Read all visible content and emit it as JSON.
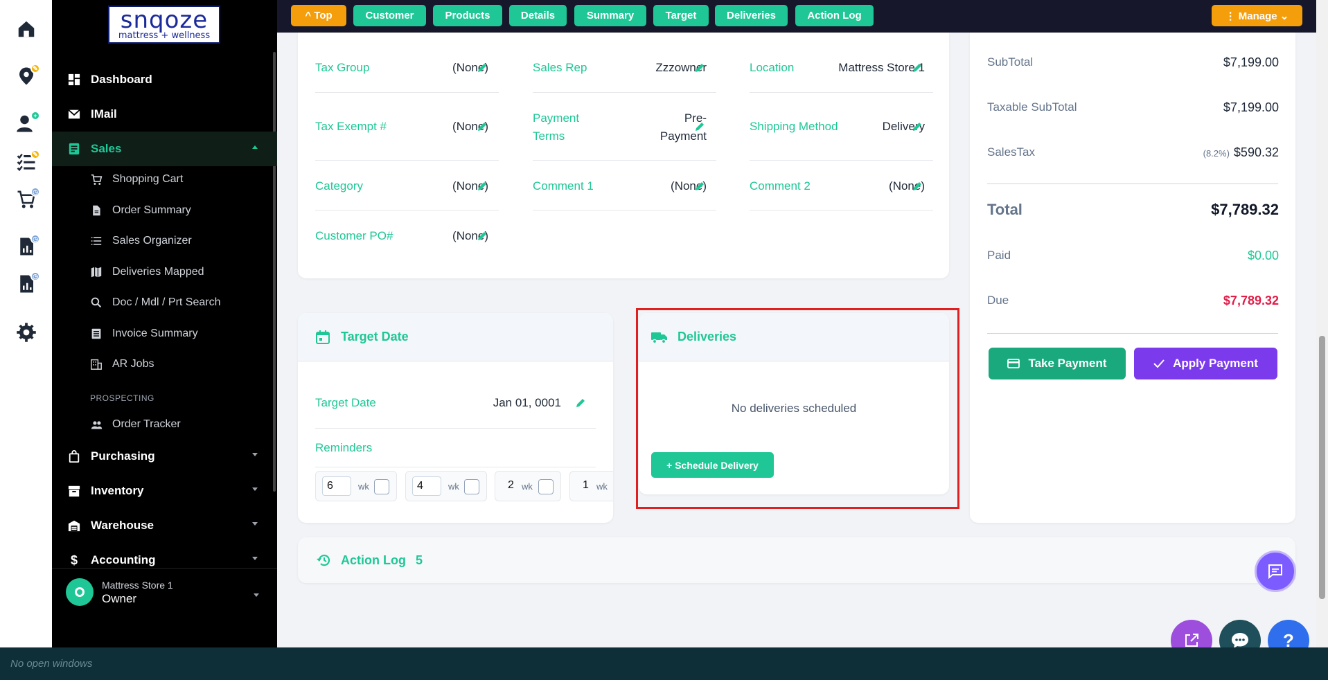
{
  "brand": {
    "logo_big": "snqoze",
    "logo_small": "mattress + wellness"
  },
  "topnav": {
    "top": "^ Top",
    "customer": "Customer",
    "products": "Products",
    "details": "Details",
    "summary": "Summary",
    "target": "Target",
    "deliveries": "Deliveries",
    "action_log": "Action Log",
    "manage": "⋮ Manage ⌄"
  },
  "sidebar": {
    "dashboard": "Dashboard",
    "imail": "IMail",
    "sales": "Sales",
    "shopping_cart": "Shopping Cart",
    "order_summary": "Order Summary",
    "sales_organizer": "Sales Organizer",
    "deliveries_mapped": "Deliveries Mapped",
    "doc_search": "Doc / Mdl / Prt Search",
    "invoice_summary": "Invoice Summary",
    "ar_jobs": "AR Jobs",
    "prospecting": "PROSPECTING",
    "order_tracker": "Order Tracker",
    "purchasing": "Purchasing",
    "inventory": "Inventory",
    "warehouse": "Warehouse",
    "accounting": "Accounting",
    "user_store": "Mattress Store 1",
    "user_role": "Owner"
  },
  "details": {
    "tax_group_label": "Tax Group",
    "tax_group_value": "(None)",
    "sales_rep_label": "Sales Rep",
    "sales_rep_value": "Zzzowner",
    "location_label": "Location",
    "location_value": "Mattress Store 1",
    "tax_exempt_label": "Tax Exempt #",
    "tax_exempt_value": "(None)",
    "payment_terms_label_1": "Payment",
    "payment_terms_label_2": "Terms",
    "payment_terms_value_1": "Pre-",
    "payment_terms_value_2": "Payment",
    "shipping_method_label": "Shipping Method",
    "shipping_method_value": "Delivery",
    "category_label": "Category",
    "category_value": "(None)",
    "comment1_label": "Comment 1",
    "comment1_value": "(None)",
    "comment2_label": "Comment 2",
    "comment2_value": "(None)",
    "customer_po_label": "Customer PO#",
    "customer_po_value": "(None)"
  },
  "target": {
    "header": "Target Date",
    "label": "Target Date",
    "value": "Jan 01, 0001",
    "reminders": "Reminders",
    "reminder_values": [
      "6",
      "4",
      "2",
      "1"
    ],
    "unit": "wk"
  },
  "deliveries": {
    "header": "Deliveries",
    "empty": "No deliveries scheduled",
    "schedule": "+ Schedule Delivery"
  },
  "action_log": {
    "label": "Action Log",
    "count": "5"
  },
  "summary": {
    "subtotal_label": "SubTotal",
    "subtotal_value": "$7,199.00",
    "taxable_label": "Taxable SubTotal",
    "taxable_value": "$7,199.00",
    "salestax_label": "SalesTax",
    "salestax_rate": "(8.2%)",
    "salestax_value": "$590.32",
    "total_label": "Total",
    "total_value": "$7,789.32",
    "paid_label": "Paid",
    "paid_value": "$0.00",
    "due_label": "Due",
    "due_value": "$7,789.32",
    "take_payment": "Take Payment",
    "apply_payment": "Apply Payment"
  },
  "taskbar": {
    "text": "No open windows"
  },
  "colors": {
    "accent": "#1fc796",
    "orange": "#f59e0b",
    "purple": "#7c3aed",
    "due": "#e11d48",
    "highlight": "#e02020"
  }
}
